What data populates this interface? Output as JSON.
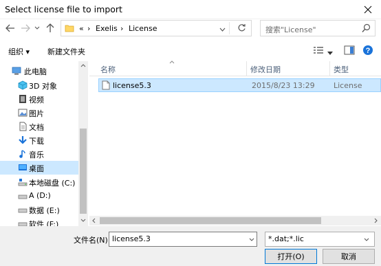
{
  "window": {
    "title": "Select license file to import"
  },
  "address": {
    "breadcrumbs": [
      "«",
      "Exelis",
      "License"
    ],
    "search_placeholder": "搜索\"License\""
  },
  "toolbar": {
    "organize_label": "组织 ▾",
    "new_folder_label": "新建文件夹"
  },
  "nav": {
    "items": [
      {
        "label": "此电脑",
        "icon": "computer-icon"
      },
      {
        "label": "3D 对象",
        "icon": "cube-icon"
      },
      {
        "label": "视频",
        "icon": "video-icon"
      },
      {
        "label": "图片",
        "icon": "picture-icon"
      },
      {
        "label": "文档",
        "icon": "document-icon"
      },
      {
        "label": "下载",
        "icon": "download-icon"
      },
      {
        "label": "音乐",
        "icon": "music-icon"
      },
      {
        "label": "桌面",
        "icon": "desktop-icon"
      },
      {
        "label": "本地磁盘 (C:)",
        "icon": "drive-icon"
      },
      {
        "label": "A (D:)",
        "icon": "drive-icon"
      },
      {
        "label": "数据 (E:)",
        "icon": "drive-icon"
      },
      {
        "label": "软件 (F:)",
        "icon": "drive-icon"
      }
    ]
  },
  "file_list": {
    "columns": [
      "名称",
      "修改日期",
      "类型"
    ],
    "rows": [
      {
        "name": "license5.3",
        "modified": "2015/8/23 13:29",
        "type": "License"
      }
    ]
  },
  "bottom": {
    "filename_label": "文件名(N):",
    "filename_value": "license5.3",
    "filter_value": "*.dat;*.lic",
    "open_label": "打开(O)",
    "cancel_label": "取消"
  },
  "colors": {
    "selection": "#cce8ff",
    "selection_border": "#99d1ff",
    "accent": "#0078d7"
  }
}
